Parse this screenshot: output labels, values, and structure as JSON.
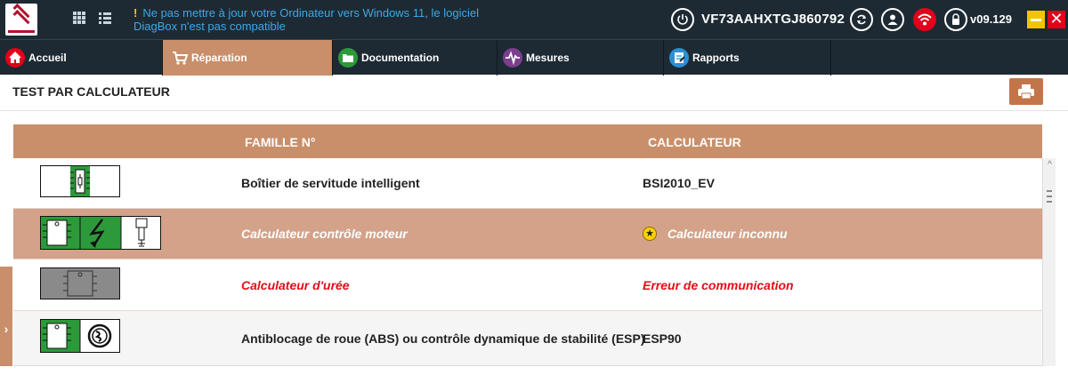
{
  "topbar": {
    "notice_bang": "!",
    "notice_text": "Ne pas mettre à jour votre Ordinateur vers Windows 11, le logiciel DiagBox n'est pas compatible",
    "vin": "VF73AAHXTGJ860792",
    "version": "v09.129",
    "close_glyph": "✕",
    "icons": [
      "grid-icon",
      "list-icon",
      "power-icon",
      "refresh-icon",
      "user-icon",
      "wifi-icon",
      "lock-icon"
    ]
  },
  "nav": {
    "tabs": [
      {
        "label": "Accueil",
        "icon": "home-icon",
        "color": "#e2001a"
      },
      {
        "label": "Réparation",
        "icon": "cart-icon",
        "color": "#c98f6a",
        "active": true
      },
      {
        "label": "Documentation",
        "icon": "folder-icon",
        "color": "#2c9a3a"
      },
      {
        "label": "Mesures",
        "icon": "waveform-icon",
        "color": "#7b3f8c"
      },
      {
        "label": "Rapports",
        "icon": "report-icon",
        "color": "#2a8fd6"
      }
    ]
  },
  "page": {
    "title": "TEST PAR CALCULATEUR",
    "sidetab_glyph": "›"
  },
  "table": {
    "headers": [
      "FAMILLE N°",
      "CALCULATEUR"
    ],
    "rows": [
      {
        "famille": "Boîtier de servitude intelligent",
        "calculateur": "BSI2010_EV",
        "state": "normal"
      },
      {
        "famille": "Calculateur contrôle moteur",
        "calculateur": "Calculateur inconnu",
        "state": "selected",
        "star": "★"
      },
      {
        "famille": "Calculateur d'urée",
        "calculateur": "Erreur de communication",
        "state": "error"
      },
      {
        "famille": "Antiblocage de roue (ABS) ou contrôle dynamique de stabilité (ESP)",
        "calculateur": "ESP90",
        "state": "normal"
      }
    ]
  },
  "colors": {
    "topbar_bg": "#1e2a33",
    "accent": "#c98f6a",
    "selected_row": "#d4a288",
    "error_text": "#e30d17",
    "notice_text": "#3ca8e6"
  }
}
